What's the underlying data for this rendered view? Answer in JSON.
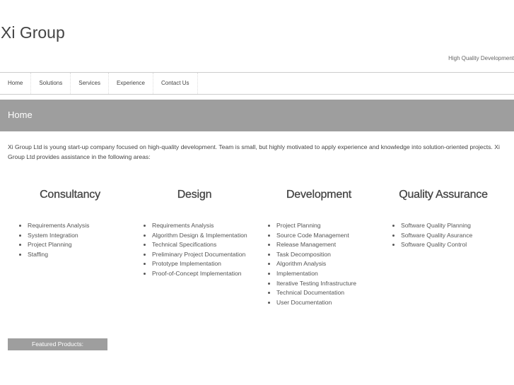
{
  "header": {
    "title": "Xi Group",
    "tagline": "High Quality Development"
  },
  "nav": [
    "Home",
    "Solutions",
    "Services",
    "Experience",
    "Contact Us"
  ],
  "page_title": "Home",
  "intro": "Xi Group Ltd is young start-up company focused on high-quality development. Team is small, but highly motivated to apply experience and knowledge into solution-oriented projects. Xi Group Ltd provides assistance in the following areas:",
  "columns": [
    {
      "title": "Consultancy",
      "items": [
        "Requirements Analysis",
        "System Integration",
        "Project Planning",
        "Staffing"
      ]
    },
    {
      "title": "Design",
      "items": [
        "Requirements Analysis",
        "Algorithm Design & Implementation",
        "Technical Specifications",
        "Preliminary Project Documentation",
        "Prototype Implementation",
        "Proof-of-Concept Implementation"
      ]
    },
    {
      "title": "Development",
      "items": [
        "Project Planning",
        "Source Code Management",
        "Release Management",
        "Task Decomposition",
        "Algorithm Analysis",
        "Implementation",
        "Iterative Testing Infrastructure",
        "Technical Documentation",
        "User Documentation"
      ]
    },
    {
      "title": "Quality Assurance",
      "items": [
        "Software Quality Planning",
        "Software Quality Asurance",
        "Software Quality Control"
      ]
    }
  ],
  "featured_label": "Featured Products:"
}
